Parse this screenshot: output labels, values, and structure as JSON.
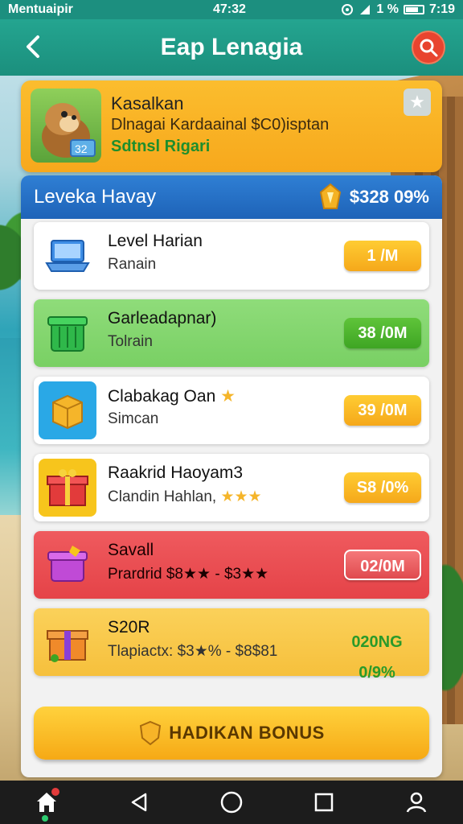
{
  "status_bar": {
    "carrier": "Mentuaipir",
    "time": "47:32",
    "battery": "1 %",
    "clock": "7:19"
  },
  "header": {
    "title": "Eap Lenagia"
  },
  "promo": {
    "title": "Kasalkan",
    "subtitle": "Dlnagai Kardaainal $C0)isptan",
    "link": "Sdtnsl Rigari"
  },
  "panel": {
    "title": "Leveka Havay",
    "amount": "$328 09%"
  },
  "items": [
    {
      "name": "Level Harian",
      "desc": "Ranain",
      "value": "1 /M"
    },
    {
      "name": "Garleadapnar)",
      "desc": "Tolrain",
      "value": "38 /0M"
    },
    {
      "name": "Clabakag Oan",
      "desc": "Simcan",
      "value": "39 /0M"
    },
    {
      "name": "Raakrid Haoyam3",
      "desc": "Clandin Hahlan,",
      "value": "S8 /0%"
    },
    {
      "name": "Savall",
      "desc": "Prardrid $8★★ - $3★★",
      "value": "02/0M"
    },
    {
      "name": "S20R",
      "desc": "Tlapiactx: $3★% - $8$81",
      "value": "020NG 0/9%"
    }
  ],
  "bonus_button": "HADIKAN BONUS",
  "colors": {
    "teal": "#1b8f7d",
    "orange": "#f7a81c",
    "blue": "#1e63b8",
    "green": "#79d064",
    "red": "#e54348"
  }
}
